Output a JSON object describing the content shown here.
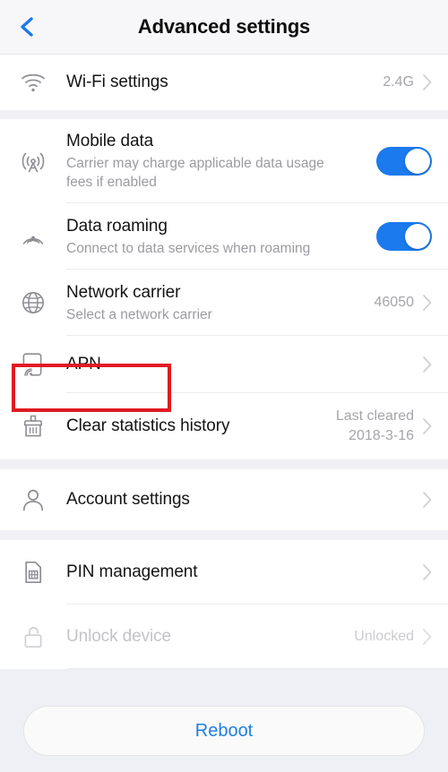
{
  "header": {
    "title": "Advanced settings",
    "back_icon": "chevron-left-icon",
    "accent_color": "#1a7aee"
  },
  "sections": [
    {
      "rows": [
        {
          "key": "wifi-settings",
          "icon": "wifi-icon",
          "title": "Wi-Fi settings",
          "sub": "",
          "value": "2.4G",
          "control": "chevron",
          "disabled": false
        }
      ]
    },
    {
      "rows": [
        {
          "key": "mobile-data",
          "icon": "cell-tower-icon",
          "title": "Mobile data",
          "sub": "Carrier may charge applicable data usage fees if enabled",
          "value": "",
          "control": "toggle",
          "toggle_on": true,
          "disabled": false
        },
        {
          "key": "data-roaming",
          "icon": "roaming-signal-icon",
          "title": "Data roaming",
          "sub": "Connect to data services when roaming",
          "value": "",
          "control": "toggle",
          "toggle_on": true,
          "disabled": false
        },
        {
          "key": "network-carrier",
          "icon": "globe-icon",
          "title": "Network carrier",
          "sub": "Select a network carrier",
          "value": "46050",
          "control": "chevron",
          "disabled": false
        },
        {
          "key": "apn",
          "icon": "apn-device-icon",
          "title": "APN",
          "sub": "",
          "value": "",
          "control": "chevron",
          "disabled": false,
          "highlighted": true
        },
        {
          "key": "clear-statistics-history",
          "icon": "brush-icon",
          "title": "Clear statistics history",
          "sub": "",
          "value": "Last cleared\n2018-3-16",
          "control": "chevron",
          "disabled": false
        }
      ]
    },
    {
      "rows": [
        {
          "key": "account-settings",
          "icon": "person-icon",
          "title": "Account settings",
          "sub": "",
          "value": "",
          "control": "chevron",
          "disabled": false
        }
      ]
    },
    {
      "rows": [
        {
          "key": "pin-management",
          "icon": "sim-card-icon",
          "title": "PIN management",
          "sub": "",
          "value": "",
          "control": "chevron",
          "disabled": false
        },
        {
          "key": "unlock-device",
          "icon": "unlock-padlock-icon",
          "title": "Unlock device",
          "sub": "",
          "value": "Unlocked",
          "control": "chevron",
          "disabled": true
        }
      ]
    }
  ],
  "footer": {
    "reboot_label": "Reboot",
    "reboot_text_color": "#2080e0"
  },
  "annotation": {
    "target": "apn",
    "shape": "rectangle",
    "color": "#e01b22"
  }
}
